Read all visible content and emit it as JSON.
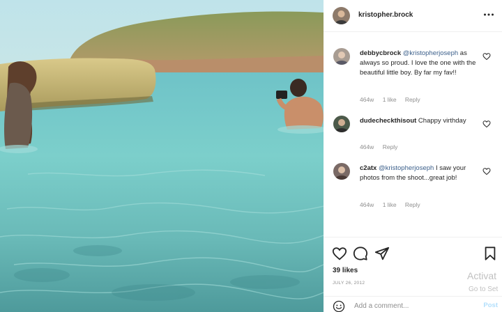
{
  "post": {
    "username": "kristopher.brock",
    "image_alt": "Photo of two people in turquoise sea water near rocks and a hill"
  },
  "comments": [
    {
      "username": "debbycbrock",
      "mention": "@kristopherjoseph",
      "text": " as always so proud. I love the one with the beautiful little boy. By far my fav!!",
      "age": "464w",
      "likes": "1 like",
      "reply": "Reply"
    },
    {
      "username": "dudecheckthisout",
      "mention": "",
      "text": " Chappy virthday",
      "age": "464w",
      "likes": "",
      "reply": "Reply"
    },
    {
      "username": "c2atx",
      "mention": "@kristopherjoseph",
      "text": " I saw your photos from the shoot...great job!",
      "age": "464w",
      "likes": "1 like",
      "reply": "Reply"
    }
  ],
  "footer": {
    "likes": "39 likes",
    "date": "JULY 26, 2012",
    "add_comment_placeholder": "Add a comment...",
    "post_label": "Post"
  },
  "watermark": {
    "line1": "Activat",
    "line2": "Go to Set"
  },
  "icons": {
    "more": "more-horizontal-icon",
    "heart": "heart-icon",
    "comment": "comment-icon",
    "share": "share-icon",
    "save": "bookmark-icon",
    "emoji": "emoji-icon"
  },
  "colors": {
    "mention": "#3b5f8a",
    "muted": "#8e8e8e",
    "post_button": "#b2dffc"
  }
}
